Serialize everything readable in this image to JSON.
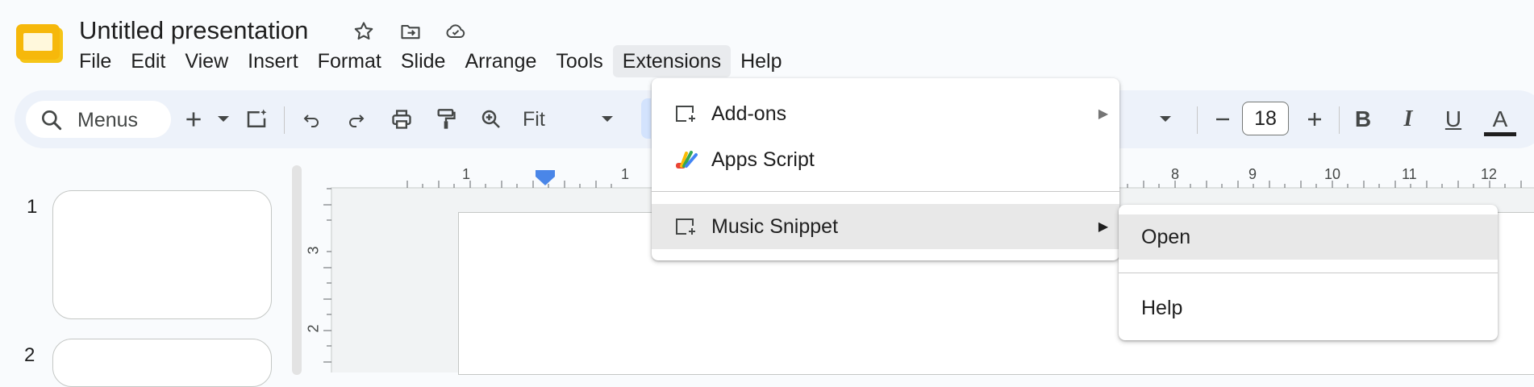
{
  "app": {
    "doc_title": "Untitled presentation"
  },
  "menubar": {
    "items": [
      "File",
      "Edit",
      "View",
      "Insert",
      "Format",
      "Slide",
      "Arrange",
      "Tools",
      "Extensions",
      "Help"
    ],
    "active": "Extensions"
  },
  "toolbar": {
    "search_label": "Menus",
    "zoom_value": "Fit",
    "font_size": "18",
    "bold_label": "B",
    "italic_label": "I",
    "underline_label": "U",
    "text_color_label": "A"
  },
  "slides_panel": {
    "slides": [
      {
        "number": "1"
      },
      {
        "number": "2"
      }
    ]
  },
  "ruler": {
    "horizontal_labels": [
      "1",
      "1",
      "8",
      "9",
      "10",
      "11",
      "12"
    ],
    "vertical_labels": [
      "3",
      "2"
    ]
  },
  "extensions_menu": {
    "items": [
      {
        "label": "Add-ons",
        "icon": "add-box-icon",
        "has_submenu": true
      },
      {
        "label": "Apps Script",
        "icon": "apps-script-icon",
        "has_submenu": false
      },
      {
        "label": "Music Snippet",
        "icon": "add-box-icon",
        "has_submenu": true
      }
    ],
    "highlighted": "Music Snippet"
  },
  "submenu": {
    "items": [
      {
        "label": "Open"
      },
      {
        "label": "Help"
      }
    ],
    "highlighted": "Open"
  },
  "colors": {
    "toolbar_bg": "#edf2fa",
    "logo_yellow": "#f6b80b",
    "ruler_marker": "#4a86e8",
    "text_color_underline": "#1f1f1f"
  }
}
